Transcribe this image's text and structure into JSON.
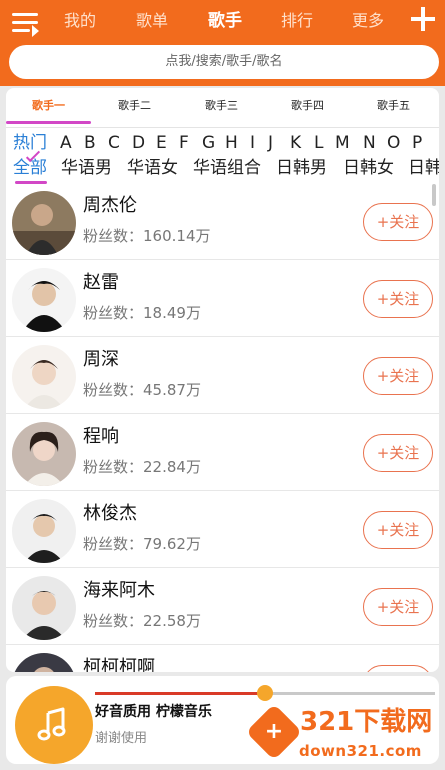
{
  "header": {
    "menu_icon": "menu-icon",
    "nav_tabs": [
      {
        "label": "我的",
        "active": false
      },
      {
        "label": "歌单",
        "active": false
      },
      {
        "label": "歌手",
        "active": true
      },
      {
        "label": "排行",
        "active": false
      },
      {
        "label": "更多",
        "active": false
      }
    ],
    "add_icon": "plus-icon",
    "accent_color": "#f26b1d"
  },
  "search": {
    "placeholder": "点我/搜索/歌手/歌名"
  },
  "sub_tabs": [
    {
      "label": "歌手一",
      "active": true
    },
    {
      "label": "歌手二",
      "active": false
    },
    {
      "label": "歌手三",
      "active": false
    },
    {
      "label": "歌手四",
      "active": false
    },
    {
      "label": "歌手五",
      "active": false
    }
  ],
  "letters": {
    "hot_label": "热门",
    "items": [
      "A",
      "B",
      "C",
      "D",
      "E",
      "F",
      "G",
      "H",
      "I",
      "J",
      "K",
      "L",
      "M",
      "N",
      "O",
      "P"
    ]
  },
  "categories": {
    "all_label": "全部",
    "items": [
      "华语男",
      "华语女",
      "华语组合",
      "日韩男",
      "日韩女",
      "日韩"
    ]
  },
  "artists": [
    {
      "name": "周杰伦",
      "fans": "粉丝数：160.14万",
      "follow": "关注"
    },
    {
      "name": "赵雷",
      "fans": "粉丝数：18.49万",
      "follow": "关注"
    },
    {
      "name": "周深",
      "fans": "粉丝数：45.87万",
      "follow": "关注"
    },
    {
      "name": "程响",
      "fans": "粉丝数：22.84万",
      "follow": "关注"
    },
    {
      "name": "林俊杰",
      "fans": "粉丝数：79.62万",
      "follow": "关注"
    },
    {
      "name": "海来阿木",
      "fans": "粉丝数：22.58万",
      "follow": "关注"
    },
    {
      "name": "柯柯柯啊",
      "fans": "",
      "follow": "关注"
    }
  ],
  "player": {
    "title": "好音质用 柠檬音乐",
    "subtitle": "谢谢使用",
    "progress": 0.5,
    "disc_icon": "music-note-icon"
  },
  "watermark": {
    "text": "321下载网",
    "url": "down321.com"
  }
}
